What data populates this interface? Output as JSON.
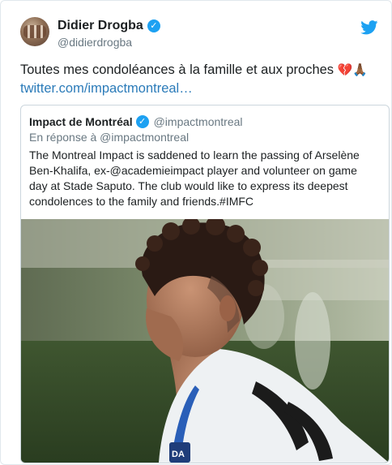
{
  "tweet": {
    "author_name": "Didier Drogba",
    "author_handle": "@didierdrogba",
    "text": "Toutes mes condoléances à la famille et aux proches",
    "emojis": "💔🙏🏾",
    "link": "twitter.com/impactmontreal…"
  },
  "quoted_tweet": {
    "author_name": "Impact de Montréal",
    "author_handle": "@impactmontreal",
    "reply_to": "En réponse à @impactmontreal",
    "text": "The Montreal Impact is saddened to learn the passing of Arselène Ben-Khalifa, ex-@academieimpact player and volunteer on game day at Stade Saputo. The club would like to express its deepest condolences to the family and friends.#IMFC",
    "jersey_number_partial": "3",
    "jersey_patch": "DA"
  },
  "colors": {
    "brand_blue": "#1da1f2",
    "link_blue": "#2b7bb9",
    "secondary_text": "#697882",
    "primary_text": "#1c2022",
    "border": "#e1e8ed"
  },
  "icons": {
    "verified": "verified-badge-icon",
    "brand": "twitter-bird-icon"
  }
}
